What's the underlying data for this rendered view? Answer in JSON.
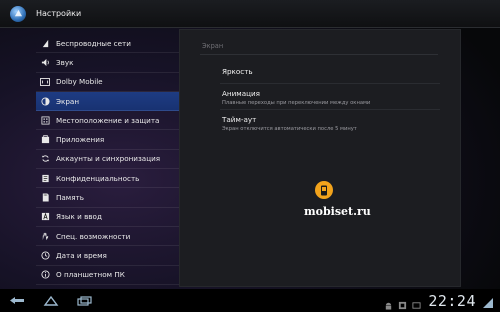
{
  "header": {
    "title": "Настройки"
  },
  "sidebar": {
    "items": [
      {
        "label": "Беспроводные сети",
        "icon": "wifi-icon"
      },
      {
        "label": "Звук",
        "icon": "volume-icon"
      },
      {
        "label": "Dolby Mobile",
        "icon": "dolby-icon"
      },
      {
        "label": "Экран",
        "icon": "brightness-icon",
        "selected": true
      },
      {
        "label": "Местоположение и защита",
        "icon": "location-security-icon"
      },
      {
        "label": "Приложения",
        "icon": "apps-icon"
      },
      {
        "label": "Аккаунты и синхронизация",
        "icon": "sync-icon"
      },
      {
        "label": "Конфиденциальность",
        "icon": "privacy-icon"
      },
      {
        "label": "Память",
        "icon": "storage-icon"
      },
      {
        "label": "Язык и ввод",
        "icon": "language-icon"
      },
      {
        "label": "Спец. возможности",
        "icon": "accessibility-icon"
      },
      {
        "label": "Дата и время",
        "icon": "clock-icon"
      },
      {
        "label": "О планшетном ПК",
        "icon": "info-icon"
      }
    ]
  },
  "panel": {
    "header": "Экран",
    "rows": [
      {
        "title": "Яркость",
        "summary": ""
      },
      {
        "title": "Анимация",
        "summary": "Плавные переходы при переключении между окнами"
      },
      {
        "title": "Тайм-аут",
        "summary": "Экран отключится автоматически после 5 минут"
      }
    ]
  },
  "watermark": {
    "text": "mobiset.ru"
  },
  "statusbar": {
    "time": "22:24"
  },
  "colors": {
    "selected": "#1e3c83",
    "panel": "#1c1d21",
    "watermark_logo": "#f2a31c"
  }
}
